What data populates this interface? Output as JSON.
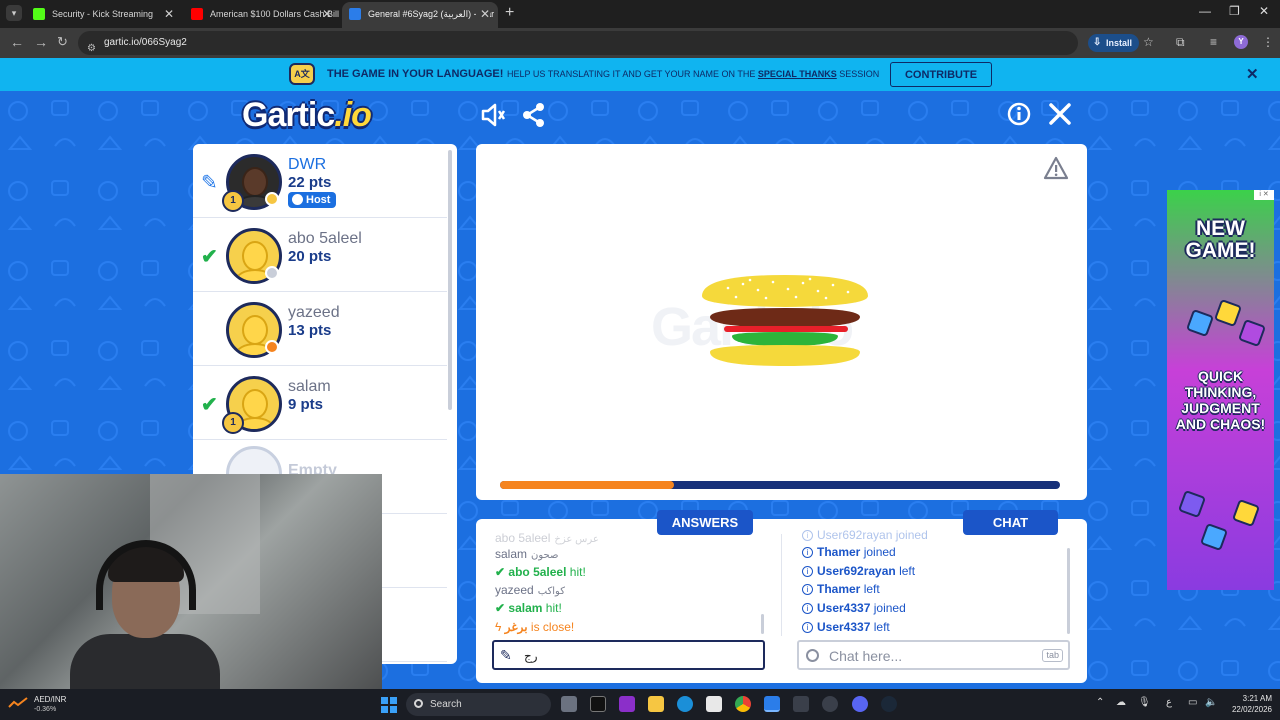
{
  "browser": {
    "tabs": [
      {
        "title": "Security - Kick Streaming",
        "favicon_color": "#53fc18"
      },
      {
        "title": "American $100 Dollars Cash Bill",
        "favicon_color": "#ff0000"
      },
      {
        "title": "General #6Syag2 (العربية) - Gar",
        "favicon_color": "#2b7de9"
      }
    ],
    "url": "gartic.io/066Syag2",
    "install_label": "Install",
    "profile_initial": "Y"
  },
  "banner": {
    "title": "THE GAME IN YOUR LANGUAGE!",
    "text_before": "HELP US TRANSLATING IT AND GET YOUR NAME ON THE",
    "link": "SPECIAL THANKS",
    "text_after": "SESSION",
    "contribute_label": "CONTRIBUTE"
  },
  "game": {
    "logo_main": "Gartic",
    "logo_suffix": ".io",
    "players": [
      {
        "name": "DWR",
        "points": "22 pts",
        "badge": "Host",
        "mark": "pencil",
        "status_color": "#f6c642",
        "trophy": "1",
        "is_me": true
      },
      {
        "name": "abo 5aleel",
        "points": "20 pts",
        "mark": "check",
        "status_color": "#c9ced9"
      },
      {
        "name": "yazeed",
        "points": "13 pts",
        "mark": "",
        "status_color": "#f5841f"
      },
      {
        "name": "salam",
        "points": "9 pts",
        "mark": "check",
        "status_color": "",
        "trophy": "1"
      }
    ],
    "empty_slot": "Empty",
    "timer_fraction": 0.31,
    "answers_label": "ANSWERS",
    "chat_label": "CHAT",
    "answers": [
      {
        "kind": "guess",
        "name": "abo 5aleel",
        "text": "عرس عزخ",
        "faded": true
      },
      {
        "kind": "guess",
        "name": "salam",
        "text": "صحون"
      },
      {
        "kind": "hit",
        "name": "abo 5aleel",
        "text": "hit!"
      },
      {
        "kind": "guess",
        "name": "yazeed",
        "text": "كواكب"
      },
      {
        "kind": "hit",
        "name": "salam",
        "text": "hit!"
      },
      {
        "kind": "close",
        "name": "برغر",
        "text": "is close!"
      }
    ],
    "chat": [
      {
        "name": "User692rayan",
        "text": "joined",
        "faded": true
      },
      {
        "name": "Thamer",
        "text": "joined"
      },
      {
        "name": "User692rayan",
        "text": "left"
      },
      {
        "name": "Thamer",
        "text": "left"
      },
      {
        "name": "User4337",
        "text": "joined"
      },
      {
        "name": "User4337",
        "text": "left"
      }
    ],
    "answer_value": "رج",
    "chat_placeholder": "Chat here...",
    "tab_hint": "tab"
  },
  "ad": {
    "headline": "NEW GAME!",
    "body": "QUICK THINKING, JUDGMENT AND CHAOS!"
  },
  "taskbar": {
    "ticker_name": "AED/INR",
    "ticker_value": "-0.36%",
    "search_label": "Search",
    "tray_lang": "ع",
    "time": "3:21 AM",
    "date": "22/02/2026"
  }
}
